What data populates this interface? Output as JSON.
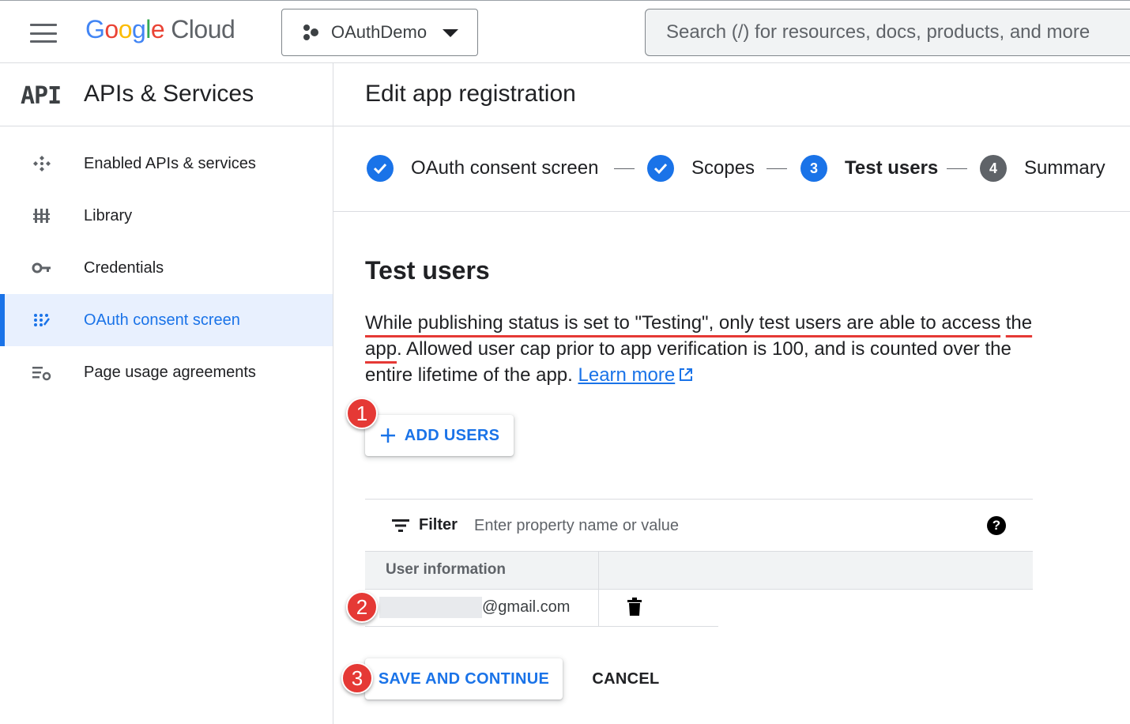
{
  "topbar": {
    "logo_google": [
      "G",
      "o",
      "o",
      "g",
      "l",
      "e"
    ],
    "logo_cloud": "Cloud",
    "project_name": "OAuthDemo",
    "search_placeholder": "Search (/) for resources, docs, products, and more"
  },
  "sidebar": {
    "logo_text": "API",
    "title": "APIs & Services",
    "items": [
      {
        "label": "Enabled APIs & services",
        "icon": "api-diamond-icon",
        "active": false
      },
      {
        "label": "Library",
        "icon": "library-icon",
        "active": false
      },
      {
        "label": "Credentials",
        "icon": "key-icon",
        "active": false
      },
      {
        "label": "OAuth consent screen",
        "icon": "dots-grid-icon",
        "active": true
      },
      {
        "label": "Page usage agreements",
        "icon": "list-settings-icon",
        "active": false
      }
    ]
  },
  "main": {
    "page_title": "Edit app registration",
    "steps": [
      {
        "label": "OAuth consent screen",
        "state": "done"
      },
      {
        "label": "Scopes",
        "state": "done"
      },
      {
        "number": "3",
        "label": "Test users",
        "state": "current"
      },
      {
        "number": "4",
        "label": "Summary",
        "state": "todo"
      }
    ],
    "section_title": "Test users",
    "desc_highlight_1": "While publishing status is set to \"Testing\", only test users are able to access",
    "desc_highlight_2": "the app",
    "desc_rest": ". Allowed user cap prior to app verification is 100, and is counted over the entire lifetime of the app.",
    "learn_more": "Learn more",
    "add_users_label": "ADD USERS",
    "filter_label": "Filter",
    "filter_placeholder": "Enter property name or value",
    "help_glyph": "?",
    "table": {
      "header_user": "User information",
      "rows": [
        {
          "email_suffix": "@gmail.com"
        }
      ]
    },
    "save_label": "SAVE AND CONTINUE",
    "cancel_label": "CANCEL",
    "annotations": [
      "1",
      "2",
      "3"
    ]
  },
  "colors": {
    "accent": "#1a73e8",
    "annotation_red": "#e53935",
    "active_bg": "#e8f0fe"
  }
}
